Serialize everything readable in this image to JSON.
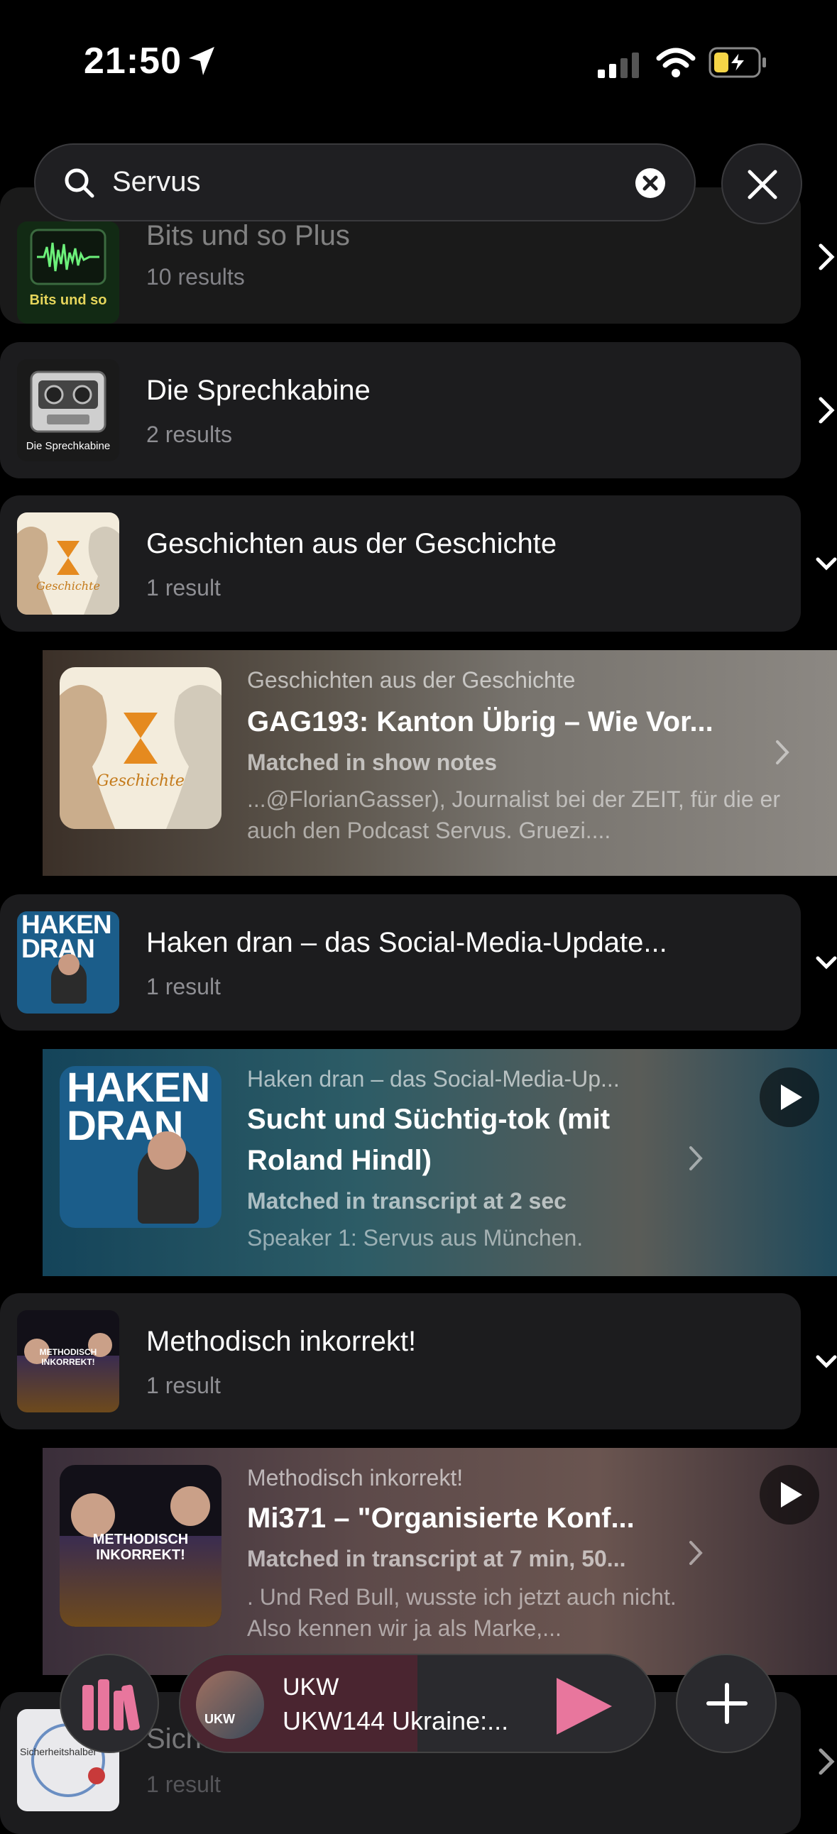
{
  "status_bar": {
    "time": "21:50"
  },
  "search": {
    "query": "Servus"
  },
  "rows": [
    {
      "title": "Bits und so Plus",
      "subtitle": "10 results",
      "art_label": "Bits und so"
    },
    {
      "title": "Die Sprechkabine",
      "subtitle": "2 results",
      "art_label": "Die Sprechkabine"
    },
    {
      "title": "Geschichten aus der Geschichte",
      "subtitle": "1 result",
      "art_label": "Geschichte"
    },
    {
      "title": "Haken dran – das Social-Media-Update...",
      "subtitle": "1 result",
      "art_label": "HAKEN DRAN"
    },
    {
      "title": "Methodisch inkorrekt!",
      "subtitle": "1 result",
      "art_label": "METHODISCH INKORREKT!"
    },
    {
      "title": "Sicherheitshalber",
      "subtitle": "1 result",
      "art_label": "Sicherheitshalber"
    }
  ],
  "cards": [
    {
      "show": "Geschichten aus der Geschichte",
      "title": "GAG193: Kanton Übrig – Wie Vor...",
      "match": "Matched in show notes",
      "snippet": "...@FlorianGasser), Journalist bei der ZEIT, für die er auch den Podcast Servus. Gruezi...."
    },
    {
      "show": "Haken dran – das Social-Media-Up...",
      "title": "Sucht und Süchtig-tok (mit Roland Hindl)",
      "match": "Matched in transcript at 2 sec",
      "snippet": "Speaker 1: Servus aus München."
    },
    {
      "show": "Methodisch inkorrekt!",
      "title": "Mi371 – \"Organisierte Konf...",
      "match": "Matched in transcript at 7 min, 50...",
      "snippet": ". Und Red Bull, wusste ich jetzt auch nicht. Also kennen wir ja als Marke,..."
    }
  ],
  "player": {
    "show": "UKW",
    "episode": "UKW144 Ukraine:...",
    "art_label": "UKW",
    "progress_fraction": 0.5
  },
  "icons": {
    "location": "location-arrow-icon",
    "signal": "cellular-signal-icon",
    "wifi": "wifi-icon",
    "battery": "battery-charging-icon",
    "search": "search-icon",
    "clear": "clear-icon",
    "close": "close-icon",
    "chevron_right": "chevron-right-icon",
    "chevron_down": "chevron-down-icon",
    "play": "play-icon",
    "library": "library-icon",
    "add": "plus-icon"
  },
  "colors": {
    "accent": "#e8769d",
    "battery": "#f5d547",
    "background": "#000000"
  }
}
